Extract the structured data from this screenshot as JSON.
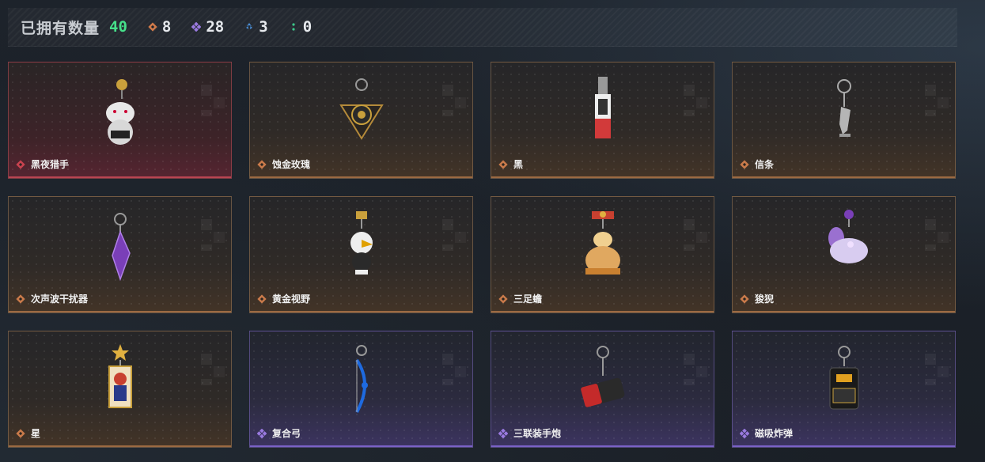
{
  "header": {
    "owned_label": "已拥有数量",
    "owned_count": "40",
    "stats": [
      {
        "icon": "orange-diamond-icon",
        "color": "#d07a4a",
        "count": "8"
      },
      {
        "icon": "purple-diamond-icon",
        "color": "#9a7ae0",
        "count": "28"
      },
      {
        "icon": "blue-chevron-icon",
        "color": "#4a8fd8",
        "count": "3"
      },
      {
        "icon": "green-dots-icon",
        "color": "#3cc88a",
        "count": "0"
      }
    ]
  },
  "items": [
    {
      "name": "黑夜猎手",
      "rarity": "red"
    },
    {
      "name": "蚀金玫瑰",
      "rarity": "orange"
    },
    {
      "name": "黑",
      "rarity": "orange"
    },
    {
      "name": "信条",
      "rarity": "orange"
    },
    {
      "name": "次声波干扰器",
      "rarity": "orange"
    },
    {
      "name": "黄金视野",
      "rarity": "orange"
    },
    {
      "name": "三足蟾",
      "rarity": "orange"
    },
    {
      "name": "狻猊",
      "rarity": "orange"
    },
    {
      "name": "星",
      "rarity": "orange"
    },
    {
      "name": "复合弓",
      "rarity": "purple"
    },
    {
      "name": "三联装手炮",
      "rarity": "purple"
    },
    {
      "name": "磁吸炸弹",
      "rarity": "purple"
    }
  ],
  "colors": {
    "red": "#c9424f",
    "orange": "#c97a4a",
    "purple": "#9a7ae0",
    "owned_count": "#46e08a"
  }
}
